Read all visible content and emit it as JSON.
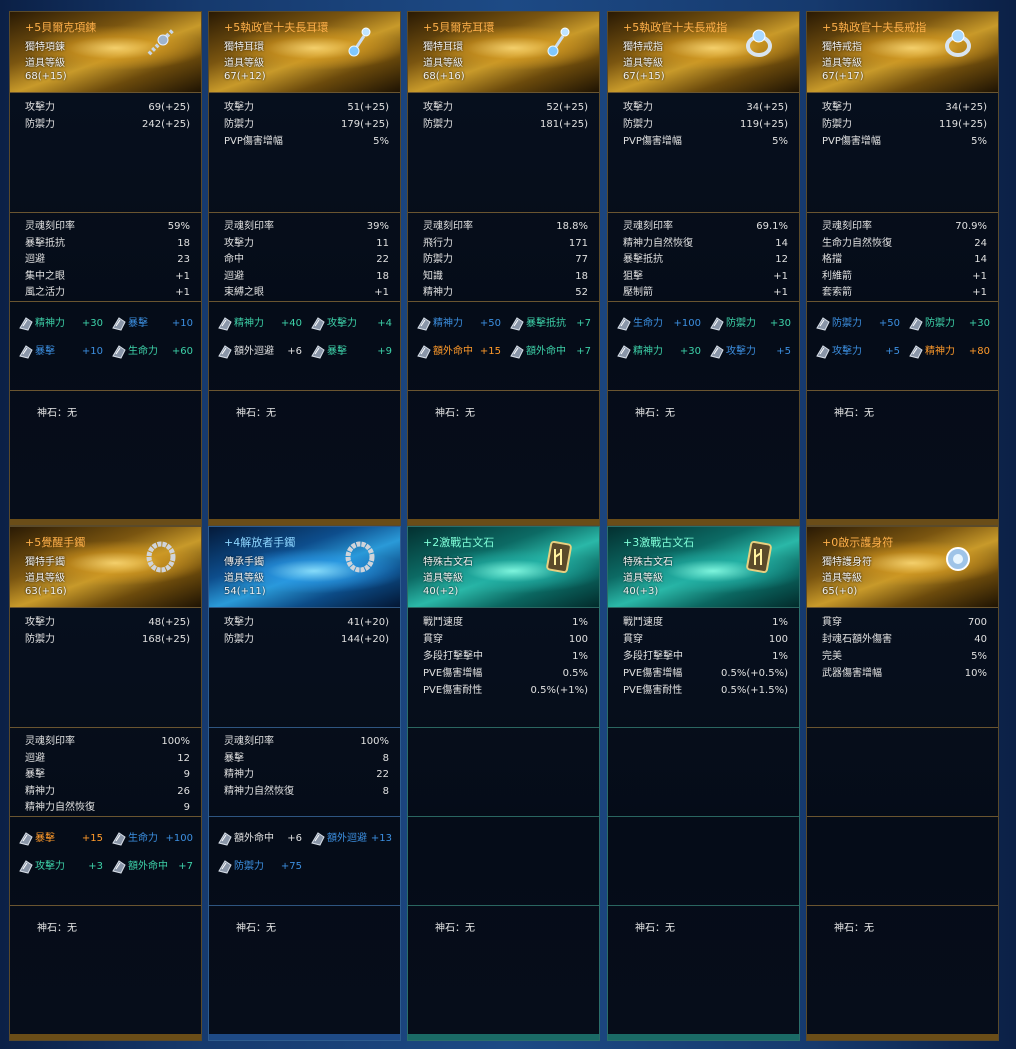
{
  "items": [
    {
      "frame": "gold",
      "icon": "necklace-icon",
      "title": "+5貝爾克項鍊",
      "type": "獨特項鍊",
      "level_label": "道具等級",
      "level": "68(+15)",
      "base": [
        [
          "攻擊力",
          "69(+25)"
        ],
        [
          "防禦力",
          "242(+25)"
        ]
      ],
      "soul": [
        [
          "灵魂刻印率",
          "59%"
        ],
        [
          "暴擊抵抗",
          "18"
        ],
        [
          "迴避",
          "23"
        ],
        [
          "集中之眼",
          "+1"
        ],
        [
          "風之活力",
          "+1"
        ]
      ],
      "gems": [
        {
          "label": "精神力",
          "value": "+30",
          "color": "#3dd1a8"
        },
        {
          "label": "暴擊",
          "value": "+10",
          "color": "#3c8fe0"
        },
        {
          "label": "暴擊",
          "value": "+10",
          "color": "#3c8fe0"
        },
        {
          "label": "生命力",
          "value": "+60",
          "color": "#3dd1a8"
        }
      ],
      "god": "神石：无"
    },
    {
      "frame": "gold",
      "icon": "earring-icon",
      "title": "+5執政官十夫長耳環",
      "type": "獨特耳環",
      "level_label": "道具等級",
      "level": "67(+12)",
      "base": [
        [
          "攻擊力",
          "51(+25)"
        ],
        [
          "防禦力",
          "179(+25)"
        ],
        [
          "PVP傷害增幅",
          "5%"
        ]
      ],
      "soul": [
        [
          "灵魂刻印率",
          "39%"
        ],
        [
          "攻擊力",
          "11"
        ],
        [
          "命中",
          "22"
        ],
        [
          "迴避",
          "18"
        ],
        [
          "束縛之眼",
          "+1"
        ]
      ],
      "gems": [
        {
          "label": "精神力",
          "value": "+40",
          "color": "#3dd1a8"
        },
        {
          "label": "攻擊力",
          "value": "+4",
          "color": "#3dd1a8"
        },
        {
          "label": "額外迴避",
          "value": "+6",
          "color": "#e0e0e0"
        },
        {
          "label": "暴擊",
          "value": "+9",
          "color": "#3dd1a8"
        }
      ],
      "god": "神石：无"
    },
    {
      "frame": "gold",
      "icon": "earring-icon",
      "title": "+5貝爾克耳環",
      "type": "獨特耳環",
      "level_label": "道具等級",
      "level": "68(+16)",
      "base": [
        [
          "攻擊力",
          "52(+25)"
        ],
        [
          "防禦力",
          "181(+25)"
        ]
      ],
      "soul": [
        [
          "灵魂刻印率",
          "18.8%"
        ],
        [
          "飛行力",
          "171"
        ],
        [
          "防禦力",
          "77"
        ],
        [
          "知識",
          "18"
        ],
        [
          "精神力",
          "52"
        ]
      ],
      "gems": [
        {
          "label": "精神力",
          "value": "+50",
          "color": "#3c8fe0"
        },
        {
          "label": "暴擊抵抗",
          "value": "+7",
          "color": "#3dd1a8"
        },
        {
          "label": "額外命中",
          "value": "+15",
          "color": "#ff9a2a"
        },
        {
          "label": "額外命中",
          "value": "+7",
          "color": "#3dd1a8"
        }
      ],
      "god": "神石：无"
    },
    {
      "frame": "gold",
      "icon": "ring-icon",
      "title": "+5執政官十夫長戒指",
      "type": "獨特戒指",
      "level_label": "道具等級",
      "level": "67(+15)",
      "base": [
        [
          "攻擊力",
          "34(+25)"
        ],
        [
          "防禦力",
          "119(+25)"
        ],
        [
          "PVP傷害增幅",
          "5%"
        ]
      ],
      "soul": [
        [
          "灵魂刻印率",
          "69.1%"
        ],
        [
          "精神力自然恢復",
          "14"
        ],
        [
          "暴擊抵抗",
          "12"
        ],
        [
          "狙擊",
          "+1"
        ],
        [
          "壓制箭",
          "+1"
        ]
      ],
      "gems": [
        {
          "label": "生命力",
          "value": "+100",
          "color": "#3c8fe0"
        },
        {
          "label": "防禦力",
          "value": "+30",
          "color": "#3dd1a8"
        },
        {
          "label": "精神力",
          "value": "+30",
          "color": "#3dd1a8"
        },
        {
          "label": "攻擊力",
          "value": "+5",
          "color": "#3c8fe0"
        }
      ],
      "god": "神石：无"
    },
    {
      "frame": "gold",
      "icon": "ring-icon",
      "title": "+5執政官十夫長戒指",
      "type": "獨特戒指",
      "level_label": "道具等級",
      "level": "67(+17)",
      "base": [
        [
          "攻擊力",
          "34(+25)"
        ],
        [
          "防禦力",
          "119(+25)"
        ],
        [
          "PVP傷害增幅",
          "5%"
        ]
      ],
      "soul": [
        [
          "灵魂刻印率",
          "70.9%"
        ],
        [
          "生命力自然恢復",
          "24"
        ],
        [
          "格擋",
          "14"
        ],
        [
          "利維箭",
          "+1"
        ],
        [
          "套索箭",
          "+1"
        ]
      ],
      "gems": [
        {
          "label": "防禦力",
          "value": "+50",
          "color": "#3c8fe0"
        },
        {
          "label": "防禦力",
          "value": "+30",
          "color": "#3dd1a8"
        },
        {
          "label": "攻擊力",
          "value": "+5",
          "color": "#3c8fe0"
        },
        {
          "label": "精神力",
          "value": "+80",
          "color": "#ff9a2a"
        }
      ],
      "god": "神石：无"
    },
    {
      "frame": "gold",
      "icon": "bracelet-icon",
      "title": "+5覺醒手鐲",
      "type": "獨特手鐲",
      "level_label": "道具等級",
      "level": "63(+16)",
      "base": [
        [
          "攻擊力",
          "48(+25)"
        ],
        [
          "防禦力",
          "168(+25)"
        ]
      ],
      "soul": [
        [
          "灵魂刻印率",
          "100%"
        ],
        [
          "迴避",
          "12"
        ],
        [
          "暴擊",
          "9"
        ],
        [
          "精神力",
          "26"
        ],
        [
          "精神力自然恢復",
          "9"
        ]
      ],
      "gems": [
        {
          "label": "暴擊",
          "value": "+15",
          "color": "#ff9a2a"
        },
        {
          "label": "生命力",
          "value": "+100",
          "color": "#3c8fe0"
        },
        {
          "label": "攻擊力",
          "value": "+3",
          "color": "#3dd1a8"
        },
        {
          "label": "額外命中",
          "value": "+7",
          "color": "#3dd1a8"
        }
      ],
      "god": "神石：无"
    },
    {
      "frame": "blue",
      "icon": "bracelet-icon",
      "title": "+4解放者手鐲",
      "type": "傳承手鐲",
      "level_label": "道具等級",
      "level": "54(+11)",
      "base": [
        [
          "攻擊力",
          "41(+20)"
        ],
        [
          "防禦力",
          "144(+20)"
        ]
      ],
      "soul": [
        [
          "灵魂刻印率",
          "100%"
        ],
        [
          "暴擊",
          "8"
        ],
        [
          "精神力",
          "22"
        ],
        [
          "精神力自然恢復",
          "8"
        ]
      ],
      "gems": [
        {
          "label": "額外命中",
          "value": "+6",
          "color": "#e0e0e0"
        },
        {
          "label": "額外迴避",
          "value": "+13",
          "color": "#3c8fe0"
        },
        {
          "label": "防禦力",
          "value": "+75",
          "color": "#3c8fe0"
        }
      ],
      "god": "神石：无"
    },
    {
      "frame": "teal",
      "icon": "rune-stone-icon",
      "title": "+2激戰古文石",
      "type": "特殊古文石",
      "level_label": "道具等級",
      "level": "40(+2)",
      "base": [
        [
          "戰鬥速度",
          "1%"
        ],
        [
          "貫穿",
          "100"
        ],
        [
          "多段打擊擊中",
          "1%"
        ],
        [
          "PVE傷害增幅",
          "0.5%"
        ],
        [
          "PVE傷害耐性",
          "0.5%(+1%)"
        ]
      ],
      "soul": [],
      "gems": [],
      "god": "神石：无"
    },
    {
      "frame": "teal",
      "icon": "rune-stone-icon",
      "title": "+3激戰古文石",
      "type": "特殊古文石",
      "level_label": "道具等級",
      "level": "40(+3)",
      "base": [
        [
          "戰鬥速度",
          "1%"
        ],
        [
          "貫穿",
          "100"
        ],
        [
          "多段打擊擊中",
          "1%"
        ],
        [
          "PVE傷害增幅",
          "0.5%(+0.5%)"
        ],
        [
          "PVE傷害耐性",
          "0.5%(+1.5%)"
        ]
      ],
      "soul": [],
      "gems": [],
      "god": "神石：无"
    },
    {
      "frame": "gold",
      "icon": "amulet-icon",
      "title": "+0啟示護身符",
      "type": "獨特護身符",
      "level_label": "道具等級",
      "level": "65(+0)",
      "base": [
        [
          "貫穿",
          "700"
        ],
        [
          "封魂石額外傷害",
          "40"
        ],
        [
          "完美",
          "5%"
        ],
        [
          "武器傷害增幅",
          "10%"
        ]
      ],
      "soul": [],
      "gems": [],
      "god": "神石：无"
    }
  ]
}
